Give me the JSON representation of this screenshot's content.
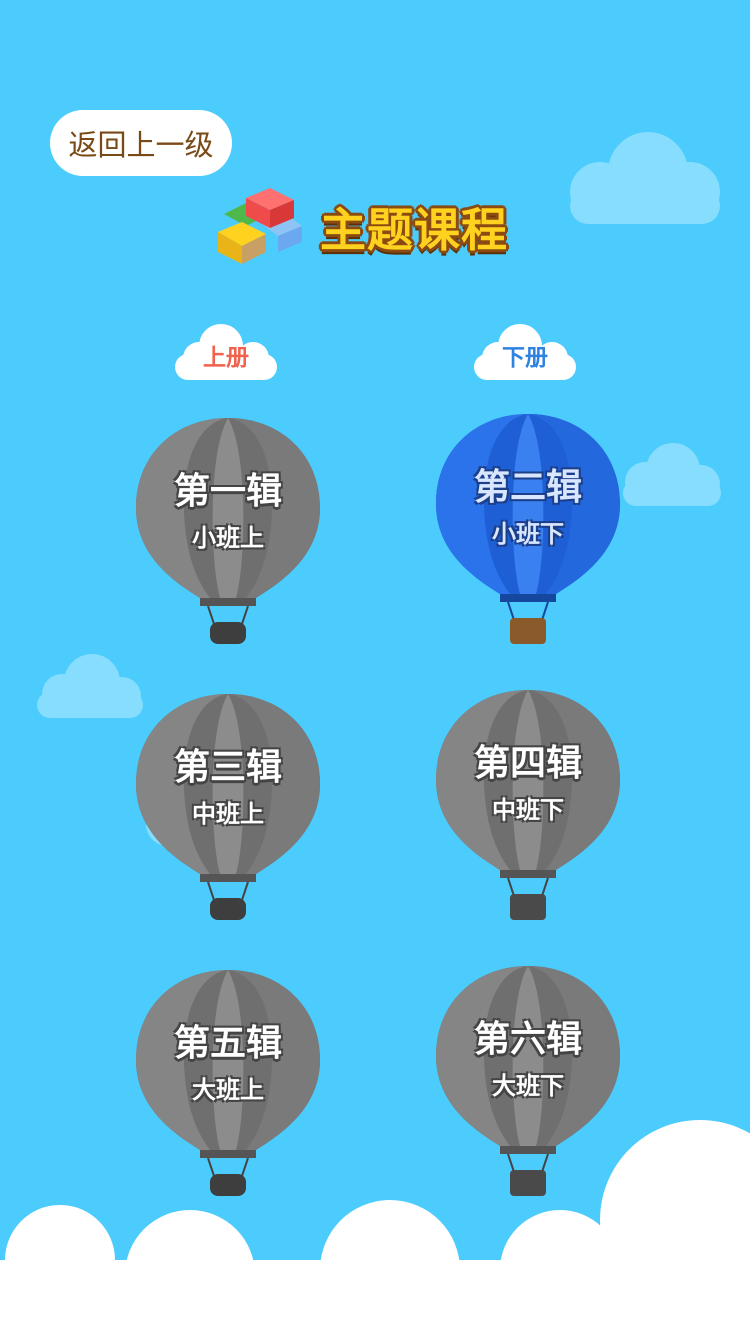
{
  "header": {
    "back_label": "返回上一级",
    "title": "主题课程"
  },
  "volumes": [
    {
      "label": "上册",
      "color": "#f0624d"
    },
    {
      "label": "下册",
      "color": "#2f83e0"
    }
  ],
  "balloons": [
    {
      "title": "第一辑",
      "subtitle": "小班上",
      "active": false
    },
    {
      "title": "第二辑",
      "subtitle": "小班下",
      "active": true
    },
    {
      "title": "第三辑",
      "subtitle": "中班上",
      "active": false
    },
    {
      "title": "第四辑",
      "subtitle": "中班下",
      "active": false
    },
    {
      "title": "第五辑",
      "subtitle": "大班上",
      "active": false
    },
    {
      "title": "第六辑",
      "subtitle": "大班下",
      "active": false
    }
  ],
  "colors": {
    "background": "#4ccbfd",
    "active_balloon": "#1e5fd6",
    "inactive_balloon": "#7d7d7d"
  }
}
